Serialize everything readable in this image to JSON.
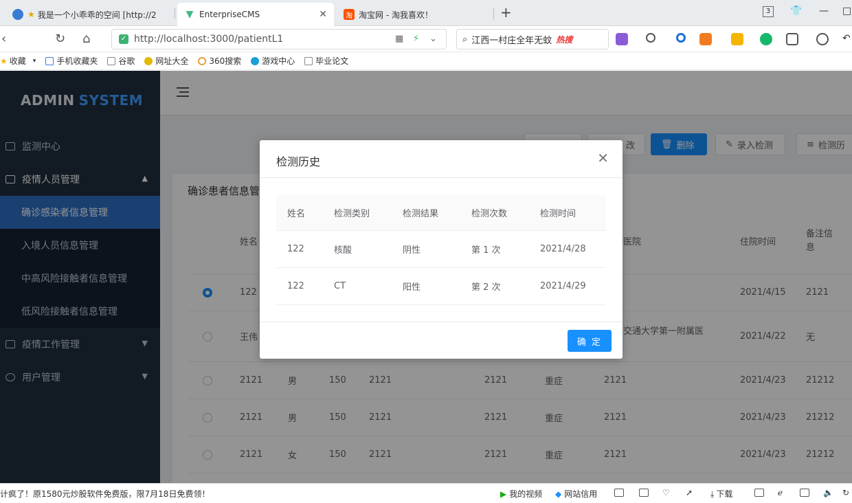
{
  "browser": {
    "tabs": [
      {
        "title": "我是一个小乖乖的空间 [http://2"
      },
      {
        "title": "EnterpriseCMS"
      },
      {
        "title": "淘宝网 - 淘我喜欢！"
      }
    ],
    "tab_count": "3",
    "url": "http://localhost:3000/patientL1",
    "search_text": "江西一村庄全年无蚊",
    "search_hot": "热搜",
    "bookmarks": [
      "收藏",
      "手机收藏夹",
      "谷歌",
      "网址大全",
      "360搜索",
      "游戏中心",
      "毕业论文"
    ]
  },
  "sidebar": {
    "logo_main": "ADMIN",
    "logo_accent": "SYSTEM",
    "items": [
      {
        "label": "监测中心"
      },
      {
        "label": "疫情人员管理"
      },
      {
        "label": "确诊感染者信息管理"
      },
      {
        "label": "入境人员信息管理"
      },
      {
        "label": "中高风险接触者信息管理"
      },
      {
        "label": "低风险接触者信息管理"
      },
      {
        "label": "疫情工作管理"
      },
      {
        "label": "用户管理"
      }
    ]
  },
  "toolbar": {
    "edit_label": "改",
    "delete_label": "删除",
    "record_label": "录入检测",
    "history_label": "检测历"
  },
  "page": {
    "card_title": "确诊患者信息管",
    "headers": {
      "name": "姓名",
      "hospital": "医院",
      "admit_time": "住院时间",
      "remark": "备注信息"
    },
    "rows": [
      {
        "name": "122",
        "gender": "",
        "age": "",
        "id": "",
        "c5": "",
        "level": "",
        "hospital": "",
        "admit": "2021/4/15",
        "remark": "2121"
      },
      {
        "name": "王伟",
        "gender": "",
        "age": "",
        "id": "",
        "c5": "",
        "level": "",
        "hospital": "交通大学第一附属医",
        "admit": "2021/4/22",
        "remark": "无"
      },
      {
        "name": "2121",
        "gender": "男",
        "age": "150",
        "id": "2121",
        "c5": "2121",
        "level": "重症",
        "hospital": "2121",
        "admit": "2021/4/23",
        "remark": "21212"
      },
      {
        "name": "2121",
        "gender": "男",
        "age": "150",
        "id": "2121",
        "c5": "2121",
        "level": "重症",
        "hospital": "2121",
        "admit": "2021/4/23",
        "remark": "21212"
      },
      {
        "name": "2121",
        "gender": "女",
        "age": "150",
        "id": "2121",
        "c5": "2121",
        "level": "重症",
        "hospital": "2121",
        "admit": "2021/4/23",
        "remark": "21212"
      }
    ]
  },
  "dialog": {
    "title": "检测历史",
    "columns": [
      "姓名",
      "检测类别",
      "检测结果",
      "检测次数",
      "检测时间"
    ],
    "rows": [
      {
        "name": "122",
        "type": "核酸",
        "result": "阴性",
        "count": "第 1 次",
        "time": "2021/4/28"
      },
      {
        "name": "122",
        "type": "CT",
        "result": "阳性",
        "count": "第 2 次",
        "time": "2021/4/29"
      }
    ],
    "confirm_label": "确 定"
  },
  "statusbar": {
    "ticker": "计疯了！原1580元炒股软件免费版，限7月18日免费领！",
    "video": "我的视频",
    "credit": "网站信用",
    "download": "下载"
  }
}
